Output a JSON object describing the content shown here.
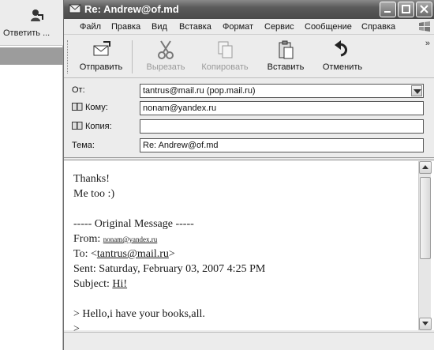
{
  "background_window": {
    "reply_label": "Ответить ..."
  },
  "window": {
    "title": "Re: Andrew@of.md"
  },
  "menu": {
    "items": [
      "Файл",
      "Правка",
      "Вид",
      "Вставка",
      "Формат",
      "Сервис",
      "Сообщение",
      "Справка"
    ]
  },
  "toolbar": {
    "send": "Отправить",
    "cut": "Вырезать",
    "copy": "Копировать",
    "paste": "Вставить",
    "undo": "Отменить",
    "more": "»"
  },
  "header": {
    "from_label": "От:",
    "from_value": "tantrus@mail.ru   (pop.mail.ru)",
    "to_label": "Кому:",
    "to_value": "nonam@yandex.ru",
    "cc_label": "Копия:",
    "cc_value": "",
    "subject_label": "Тема:",
    "subject_value": "Re: Andrew@of.md"
  },
  "message": {
    "line1": "Thanks!",
    "line2": "Me too :)",
    "orig_header": "----- Original Message -----",
    "from_label": "From: ",
    "from_value": "nonam@yandex.ru",
    "to_label": "To: <",
    "to_value": "tantrus@mail.ru",
    "to_end": ">",
    "sent": "Sent: Saturday, February 03, 2007 4:25 PM",
    "subject_label": "Subject: ",
    "subject_value": "Hi!",
    "quote1": "> Hello,i have your books,all.",
    "quote2": ">"
  }
}
